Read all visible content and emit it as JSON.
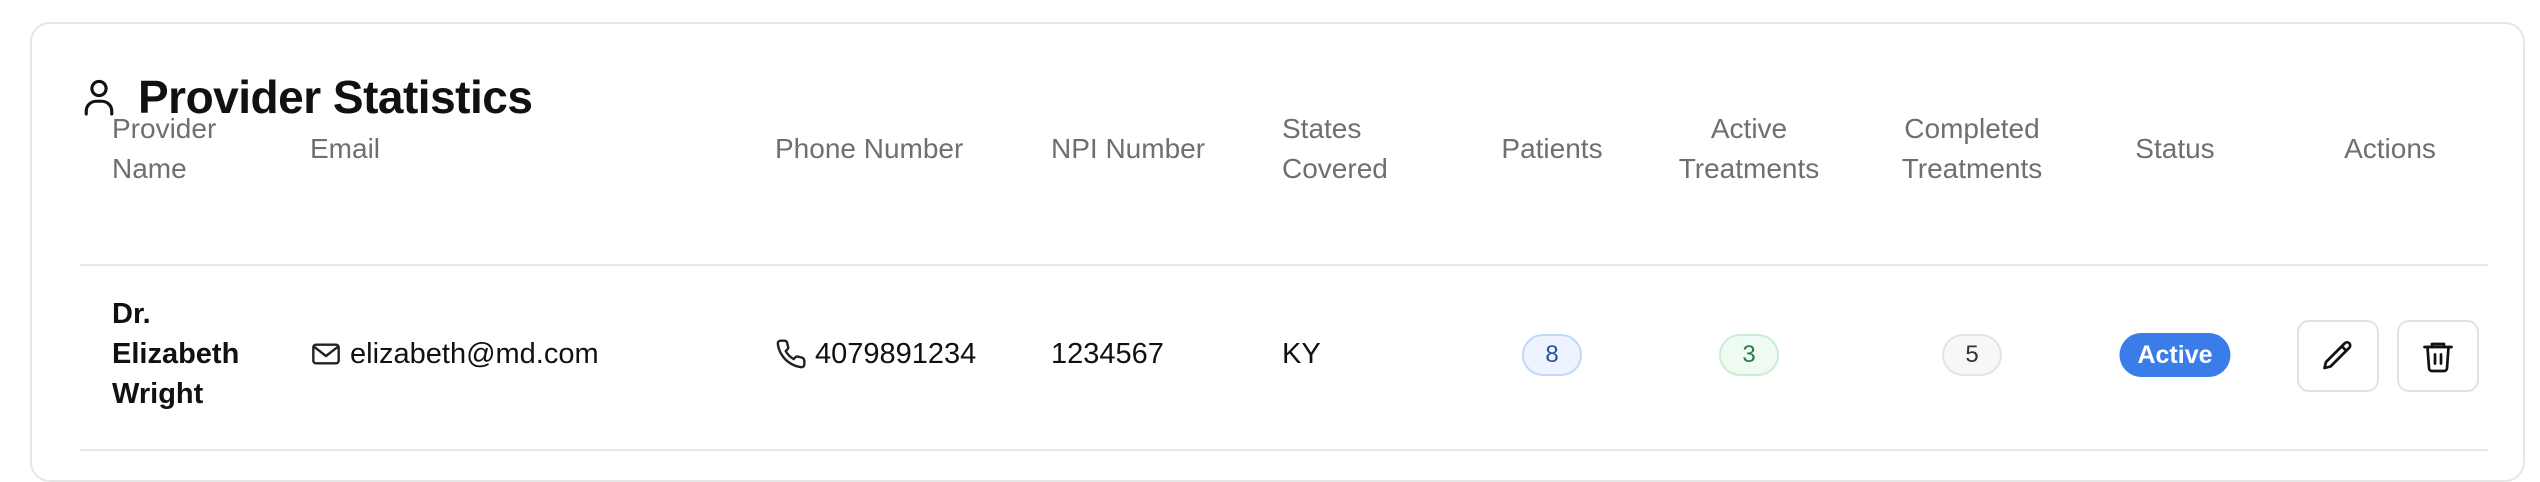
{
  "card": {
    "title": "Provider Statistics",
    "icon": "user-icon"
  },
  "table": {
    "headers": {
      "provider_name": [
        "Provider",
        "Name"
      ],
      "email": "Email",
      "phone": "Phone Number",
      "npi": "NPI Number",
      "states": [
        "States",
        "Covered"
      ],
      "patients": "Patients",
      "active": [
        "Active",
        "Treatments"
      ],
      "completed": [
        "Completed",
        "Treatments"
      ],
      "status": "Status",
      "actions": "Actions"
    },
    "rows": [
      {
        "name_lines": [
          "Dr.",
          "Elizabeth",
          "Wright"
        ],
        "email": "elizabeth@md.com",
        "phone": "4079891234",
        "npi": "1234567",
        "states": "KY",
        "patients": "8",
        "active_treatments": "3",
        "completed_treatments": "5",
        "status": "Active"
      }
    ]
  },
  "icons": {
    "email": "mail-icon",
    "phone": "phone-icon",
    "edit": "pencil-icon",
    "delete": "trash-icon"
  },
  "colors": {
    "status_active": "#3b7de8",
    "patients_badge": "#2a4fa8",
    "active_badge": "#2a7a44"
  }
}
